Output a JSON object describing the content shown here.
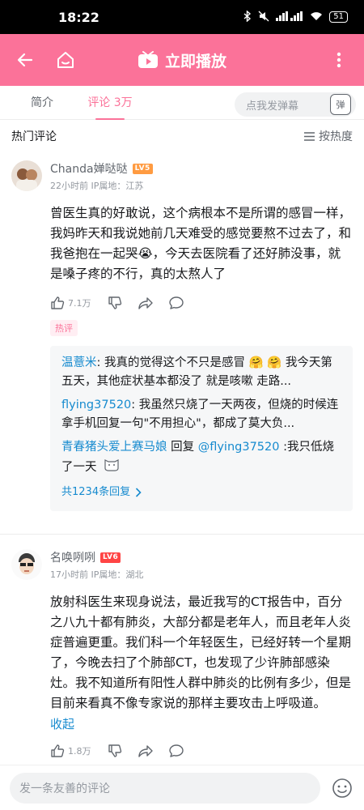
{
  "status": {
    "time": "18:22",
    "battery": "51"
  },
  "header": {
    "play_label": "立即播放"
  },
  "tabs": {
    "intro": "简介",
    "comments": "评论 3万",
    "danmaku_placeholder": "点我发弹幕",
    "danmaku_btn": "弹"
  },
  "section": {
    "title": "热门评论",
    "sort": "按热度"
  },
  "comments": [
    {
      "user": "Chanda婵哒哒",
      "level": "LV5",
      "level_color": "#ff9b41",
      "time": "22小时前",
      "ip": "IP属地：江苏",
      "text": "曾医生真的好敢说，这个病根本不是所谓的感冒一样，我妈昨天和我说她前几天难受的感觉要熬不过去了，和我爸抱在一起哭😭，今天去医院看了还好肺没事，就是嗓子疼的不行，真的太熬人了",
      "likes": "7.1万",
      "tag": "热评",
      "replies": [
        {
          "user": "温薏米",
          "text": ": 我真的觉得这个不只是感冒 🤗 🤗 我今天第五天，其他症状基本都没了 就是咳嗽 走路..."
        },
        {
          "user": "flying37520",
          "text": ": 我虽然只烧了一天两夜，但烧的时候连拿手机回复一句\"不用担心\"，都成了莫大负..."
        },
        {
          "user": "青春猪头爱上赛马娘",
          "mid": " 回复 ",
          "target": "@flying37520",
          "text": " :我只低烧了一天"
        }
      ],
      "more_replies": "共1234条回复"
    },
    {
      "user": "名唤咧咧",
      "level": "LV6",
      "level_color": "#ff4444",
      "time": "17小时前",
      "ip": "IP属地：湖北",
      "text": "放射科医生来现身说法，最近我写的CT报告中，百分之八九十都有肺炎，大部分都是老年人，而且老年人炎症普遍更重。我们科一个年轻医生，已经好转一个星期了，今晚去扫了个肺部CT，也发现了少许肺部感染灶。我不知道所有阳性人群中肺炎的比例有多少，但是目前来看真不像专家说的那样主要攻击上呼吸道。",
      "collapse": "收起",
      "likes": "1.8万"
    }
  ],
  "bottom": {
    "placeholder": "发一条友善的评论"
  }
}
